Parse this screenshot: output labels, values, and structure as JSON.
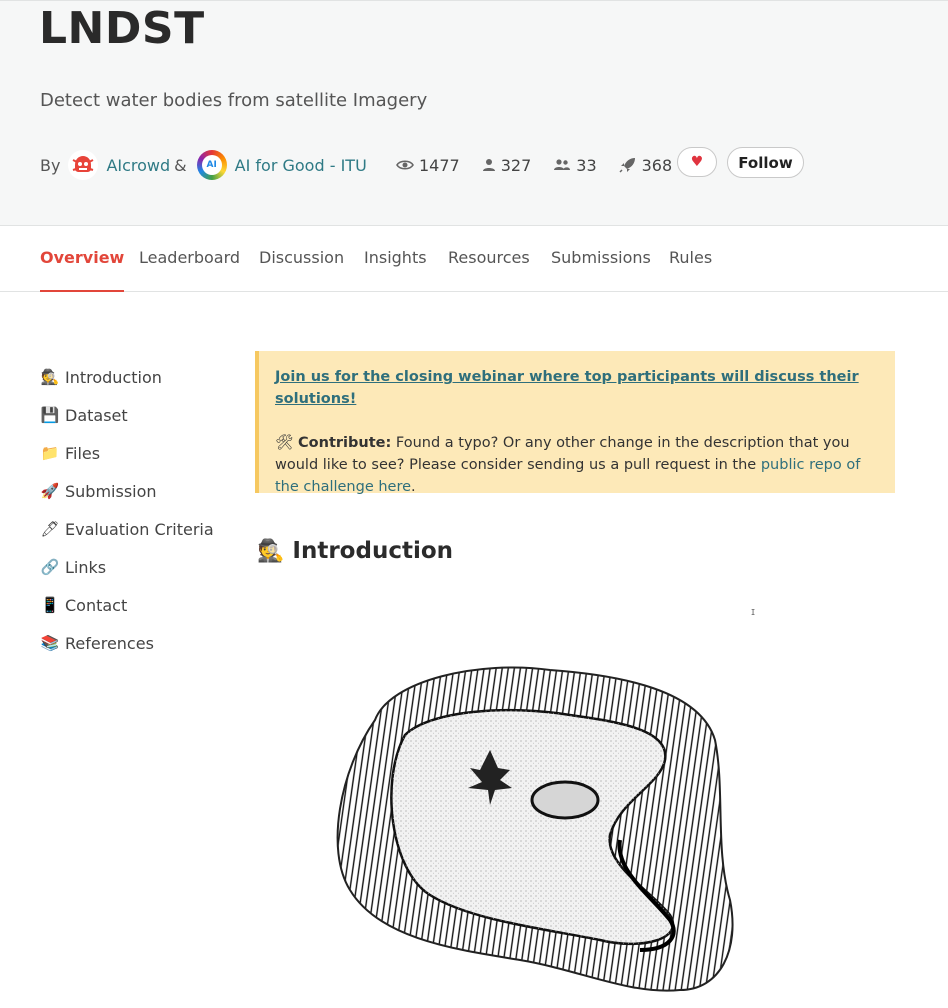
{
  "challenge": {
    "title": "LNDST",
    "subtitle": "Detect water bodies from satellite Imagery"
  },
  "byline": {
    "prefix": "By",
    "org1": "AIcrowd",
    "amp": "&",
    "org2_logo_text": "AI",
    "org2": "AI for Good - ITU"
  },
  "stats": {
    "views": "1477",
    "participants": "327",
    "teams": "33",
    "submissions": "368"
  },
  "actions": {
    "like_icon": "heart-icon",
    "follow_label": "Follow"
  },
  "tabs": [
    {
      "label": "Overview",
      "active": true
    },
    {
      "label": "Leaderboard"
    },
    {
      "label": "Discussion"
    },
    {
      "label": "Insights"
    },
    {
      "label": "Resources"
    },
    {
      "label": "Submissions"
    },
    {
      "label": "Rules"
    }
  ],
  "sidebar": {
    "items": [
      {
        "icon": "🕵️",
        "label": "Introduction"
      },
      {
        "icon": "💾",
        "label": "Dataset"
      },
      {
        "icon": "📁",
        "label": "Files"
      },
      {
        "icon": "🚀",
        "label": "Submission"
      },
      {
        "icon": "🖊",
        "label": "Evaluation Criteria"
      },
      {
        "icon": "🔗",
        "label": "Links"
      },
      {
        "icon": "📱",
        "label": "Contact"
      },
      {
        "icon": "📚",
        "label": "References"
      }
    ]
  },
  "notice": {
    "headline": "Join us for the closing webinar where top participants will discuss their solutions!",
    "contribute_icon": "🛠",
    "contribute_label": "Contribute:",
    "contribute_text": " Found a typo? Or any other change in the description that you would like to see? Please consider sending us a pull request in the ",
    "repo_link": "public repo of the challenge here",
    "end": "."
  },
  "introduction": {
    "icon": "🕵️",
    "heading": "Introduction",
    "stray_mark": "ɪ"
  },
  "colors": {
    "accent": "#e2463a",
    "link": "#2f7a85",
    "notice_bg": "#fde9b8",
    "notice_border": "#f6c860",
    "hero_bg": "#f6f7f7"
  }
}
